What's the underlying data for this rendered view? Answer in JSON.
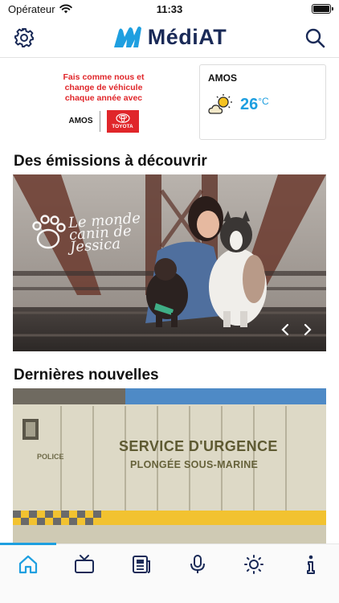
{
  "status_bar": {
    "carrier": "Opérateur",
    "time": "11:33",
    "battery_level": 1.0
  },
  "header": {
    "logo_text": "MédiAT",
    "settings_icon": "gear-icon",
    "search_icon": "search-icon",
    "brand_color": "#1a2a57",
    "logo_accent_color": "#1e9fe0"
  },
  "ad": {
    "line1": "Fais comme nous et",
    "line2": "change de véhicule",
    "line3": "chaque année avec",
    "city": "AMOS",
    "brand": "TOYOTA",
    "color": "#e0262a"
  },
  "weather": {
    "city": "AMOS",
    "temperature": "26",
    "unit": "°C",
    "icon": "partly-sunny-icon"
  },
  "sections": {
    "shows_title": "Des émissions à découvrir",
    "news_title": "Dernières nouvelles"
  },
  "featured_show": {
    "logo_line1": "Le monde",
    "logo_line2": "canin de",
    "logo_line3": "Jessica"
  },
  "news_item": {
    "truck_title": "SERVICE D'URGENCE",
    "truck_subtitle": "PLONGÉE SOUS-MARINE",
    "truck_police": "POLICE"
  },
  "bottom_nav": {
    "active_tab": "home",
    "items": [
      "home-icon",
      "tv-icon",
      "news-icon",
      "microphone-icon",
      "weather-icon",
      "info-icon"
    ],
    "active_color": "#1e9fe0"
  }
}
